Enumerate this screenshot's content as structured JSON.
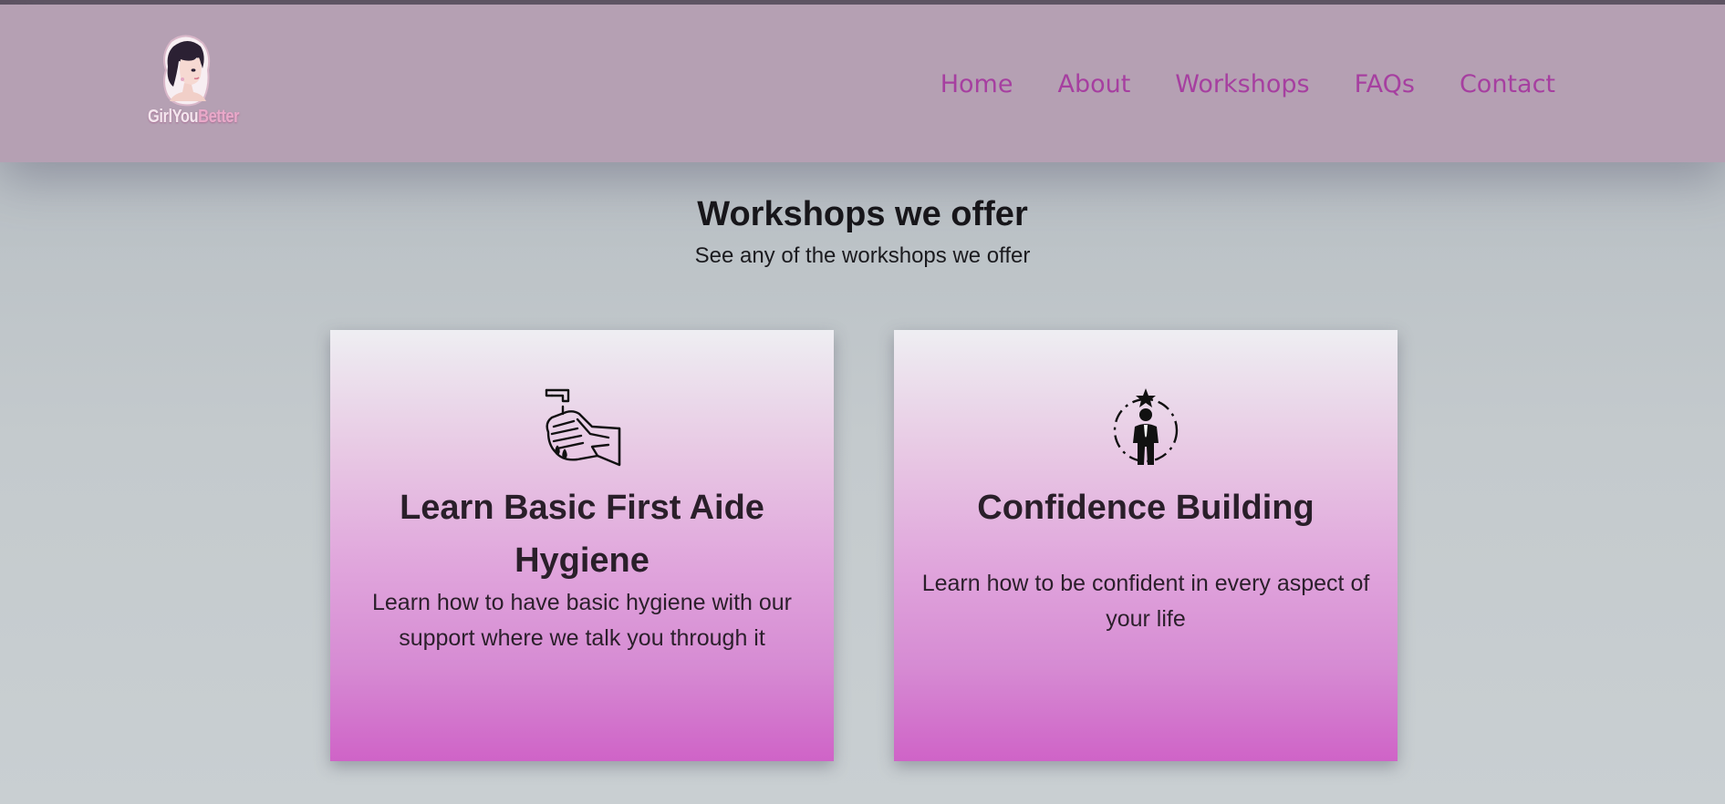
{
  "brand": {
    "logo_text_primary": "GirlYou",
    "logo_text_accent": "Better",
    "logo_icon": "girl-portrait-icon"
  },
  "nav": {
    "items": [
      {
        "label": "Home"
      },
      {
        "label": "About"
      },
      {
        "label": "Workshops"
      },
      {
        "label": "FAQs"
      },
      {
        "label": "Contact"
      }
    ]
  },
  "section": {
    "title": "Workshops we offer",
    "subtitle": "See any of the workshops we offer"
  },
  "cards": [
    {
      "icon": "hand-washing-icon",
      "title": "Learn Basic First Aide Hygiene",
      "description": "Learn how to have basic hygiene with our support where we talk you through it"
    },
    {
      "icon": "confident-person-icon",
      "title": "Confidence Building",
      "description": "Learn how to be confident in every aspect of your life"
    }
  ],
  "colors": {
    "header_bg": "#b5a0b3",
    "nav_link": "#a63fa0",
    "card_gradient_bottom": "#cf63c7",
    "page_bg": "#c4cacd"
  }
}
